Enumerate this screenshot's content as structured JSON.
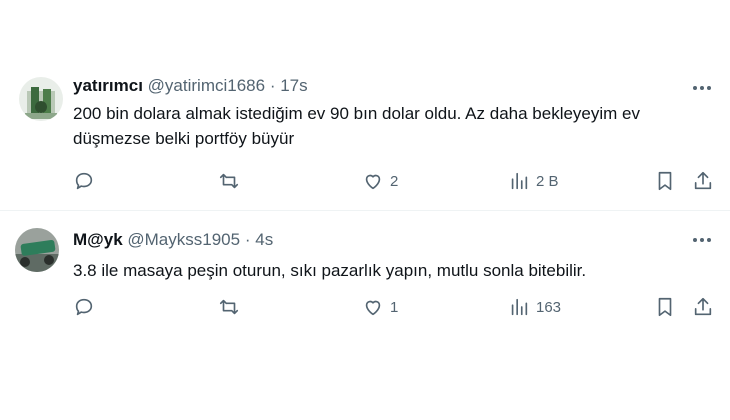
{
  "tweets": [
    {
      "name": "yatırımcı",
      "handle": "@yatirimci1686",
      "separator": "·",
      "time": "17s",
      "text": "200 bin dolara almak istediğim ev 90 bın dolar oldu. Az daha bekleyeyim ev düşmezse belki portföy büyür",
      "likes": "2",
      "views": "2 B"
    },
    {
      "name": "M@yk",
      "handle": "@Maykss1905",
      "separator": "·",
      "time": "4s",
      "text": "3.8 ile masaya peşin oturun, sıkı pazarlık yapın, mutlu sonla bitebilir.",
      "likes": "1",
      "views": "163"
    }
  ],
  "icons": {
    "reply": "reply-icon",
    "retweet": "retweet-icon",
    "like": "heart-icon",
    "views": "views-bar-chart-icon",
    "bookmark": "bookmark-icon",
    "share": "share-icon",
    "more": "more-dots-icon"
  },
  "colors": {
    "text": "#0f1419",
    "muted": "#536471",
    "divider": "#eff3f4"
  }
}
